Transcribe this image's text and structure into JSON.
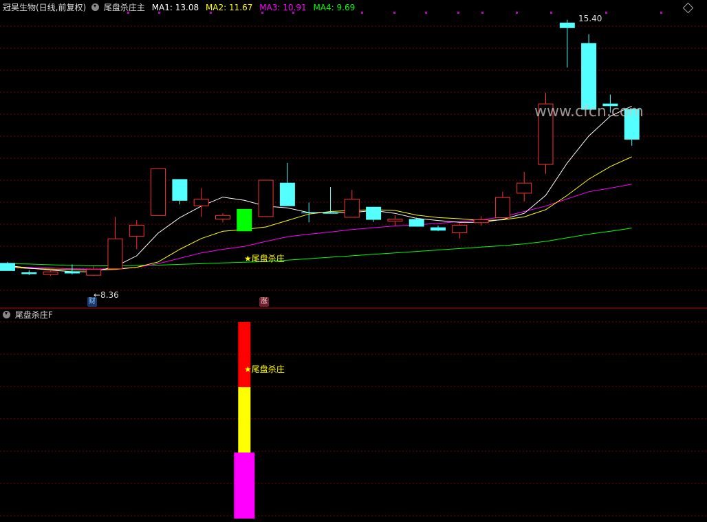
{
  "header": {
    "stock_title": "冠昊生物(日线,前复权)",
    "indicator_name": "尾盘杀庄主",
    "ma1_label": "MA1: 13.08",
    "ma2_label": "MA2: 11.67",
    "ma3_label": "MA3: 10.91",
    "ma4_label": "MA4: 9.69"
  },
  "sub_panel": {
    "title": "尾盘杀庄F",
    "signal_label": "★尾盘杀庄"
  },
  "annotations": {
    "high_label": "15.40",
    "low_label": "←8.36",
    "signal_label": "★尾盘杀庄",
    "badge_cai": "财",
    "badge_zhang": "涨",
    "watermark": "www.cfcn.com"
  },
  "colors": {
    "up": "#ff3232",
    "down": "#54ffff",
    "signal": "#00ff00",
    "ma1": "#ffffff",
    "ma2": "#ffff00",
    "ma3": "#ff00ff",
    "ma4": "#00ff00",
    "grid": "#7a0000"
  },
  "chart_data": {
    "type": "candlestick",
    "price_range": [
      8.0,
      15.8
    ],
    "candles": [
      {
        "o": 8.72,
        "c": 8.5,
        "h": 8.75,
        "l": 8.5
      },
      {
        "o": 8.46,
        "c": 8.41,
        "h": 8.52,
        "l": 8.38
      },
      {
        "o": 8.39,
        "c": 8.48,
        "h": 8.52,
        "l": 8.36
      },
      {
        "o": 8.49,
        "c": 8.43,
        "h": 8.68,
        "l": 8.4
      },
      {
        "o": 8.37,
        "c": 8.55,
        "h": 8.63,
        "l": 8.36
      },
      {
        "o": 8.55,
        "c": 9.4,
        "h": 10.0,
        "l": 8.55
      },
      {
        "o": 9.45,
        "c": 9.78,
        "h": 9.91,
        "l": 9.1
      },
      {
        "o": 10.03,
        "c": 11.35,
        "h": 11.35,
        "l": 10.03
      },
      {
        "o": 11.05,
        "c": 10.45,
        "h": 11.05,
        "l": 10.35
      },
      {
        "o": 10.3,
        "c": 10.5,
        "h": 10.8,
        "l": 10.0
      },
      {
        "o": 9.93,
        "c": 10.05,
        "h": 10.1,
        "l": 9.85
      },
      {
        "o": 10.22,
        "c": 9.6,
        "h": 10.22,
        "l": 9.6,
        "signal": true
      },
      {
        "o": 10.0,
        "c": 11.03,
        "h": 11.03,
        "l": 10.0
      },
      {
        "o": 10.95,
        "c": 10.3,
        "h": 11.5,
        "l": 10.3
      },
      {
        "o": 10.12,
        "c": 10.1,
        "h": 10.4,
        "l": 9.85
      },
      {
        "o": 10.13,
        "c": 10.09,
        "h": 10.83,
        "l": 10.09
      },
      {
        "o": 9.98,
        "c": 10.5,
        "h": 10.75,
        "l": 9.98
      },
      {
        "o": 10.28,
        "c": 9.92,
        "h": 10.28,
        "l": 9.86
      },
      {
        "o": 9.87,
        "c": 9.95,
        "h": 10.05,
        "l": 9.76
      },
      {
        "o": 9.94,
        "c": 9.73,
        "h": 9.98,
        "l": 9.73
      },
      {
        "o": 9.71,
        "c": 9.62,
        "h": 9.76,
        "l": 9.6
      },
      {
        "o": 9.55,
        "c": 9.78,
        "h": 9.82,
        "l": 9.4
      },
      {
        "o": 9.83,
        "c": 9.93,
        "h": 10.02,
        "l": 9.76
      },
      {
        "o": 9.97,
        "c": 10.55,
        "h": 10.7,
        "l": 9.97
      },
      {
        "o": 10.65,
        "c": 10.95,
        "h": 11.25,
        "l": 10.43
      },
      {
        "o": 11.45,
        "c": 13.15,
        "h": 13.45,
        "l": 11.2
      },
      {
        "o": 15.4,
        "c": 15.25,
        "h": 15.48,
        "l": 14.15
      },
      {
        "o": 14.83,
        "c": 12.98,
        "h": 15.08,
        "l": 12.98
      },
      {
        "o": 13.15,
        "c": 13.08,
        "h": 13.4,
        "l": 12.9
      },
      {
        "o": 13.0,
        "c": 12.15,
        "h": 13.0,
        "l": 11.98
      }
    ],
    "ma1": [
      8.65,
      8.58,
      8.52,
      8.48,
      8.47,
      8.62,
      8.92,
      9.55,
      9.98,
      10.3,
      10.55,
      10.46,
      10.3,
      10.25,
      10.12,
      10.12,
      10.12,
      10.18,
      10.1,
      9.96,
      9.9,
      9.85,
      9.85,
      9.93,
      10.1,
      10.6,
      11.5,
      12.25,
      12.8,
      13.08
    ],
    "ma2": [
      8.6,
      8.57,
      8.55,
      8.53,
      8.52,
      8.54,
      8.6,
      8.75,
      9.1,
      9.4,
      9.6,
      9.65,
      9.72,
      9.9,
      10.08,
      10.15,
      10.18,
      10.2,
      10.18,
      10.05,
      9.98,
      9.95,
      9.9,
      9.92,
      10.0,
      10.2,
      10.6,
      11.05,
      11.4,
      11.67
    ],
    "ma3": [
      8.62,
      8.6,
      8.58,
      8.56,
      8.55,
      8.56,
      8.6,
      8.7,
      8.85,
      9.0,
      9.1,
      9.18,
      9.32,
      9.45,
      9.52,
      9.58,
      9.65,
      9.7,
      9.75,
      9.78,
      9.82,
      9.87,
      9.92,
      10.0,
      10.15,
      10.3,
      10.5,
      10.7,
      10.8,
      10.91
    ],
    "ma4": [
      8.7,
      8.69,
      8.67,
      8.65,
      8.64,
      8.64,
      8.65,
      8.66,
      8.68,
      8.7,
      8.72,
      8.74,
      8.76,
      8.8,
      8.84,
      8.88,
      8.92,
      8.96,
      9.0,
      9.04,
      9.08,
      9.12,
      9.16,
      9.2,
      9.25,
      9.32,
      9.42,
      9.52,
      9.6,
      9.69
    ],
    "signal_bar": {
      "index": 11,
      "segments": [
        "#ff0000",
        "#ffff00",
        "#ff00ff"
      ]
    }
  }
}
